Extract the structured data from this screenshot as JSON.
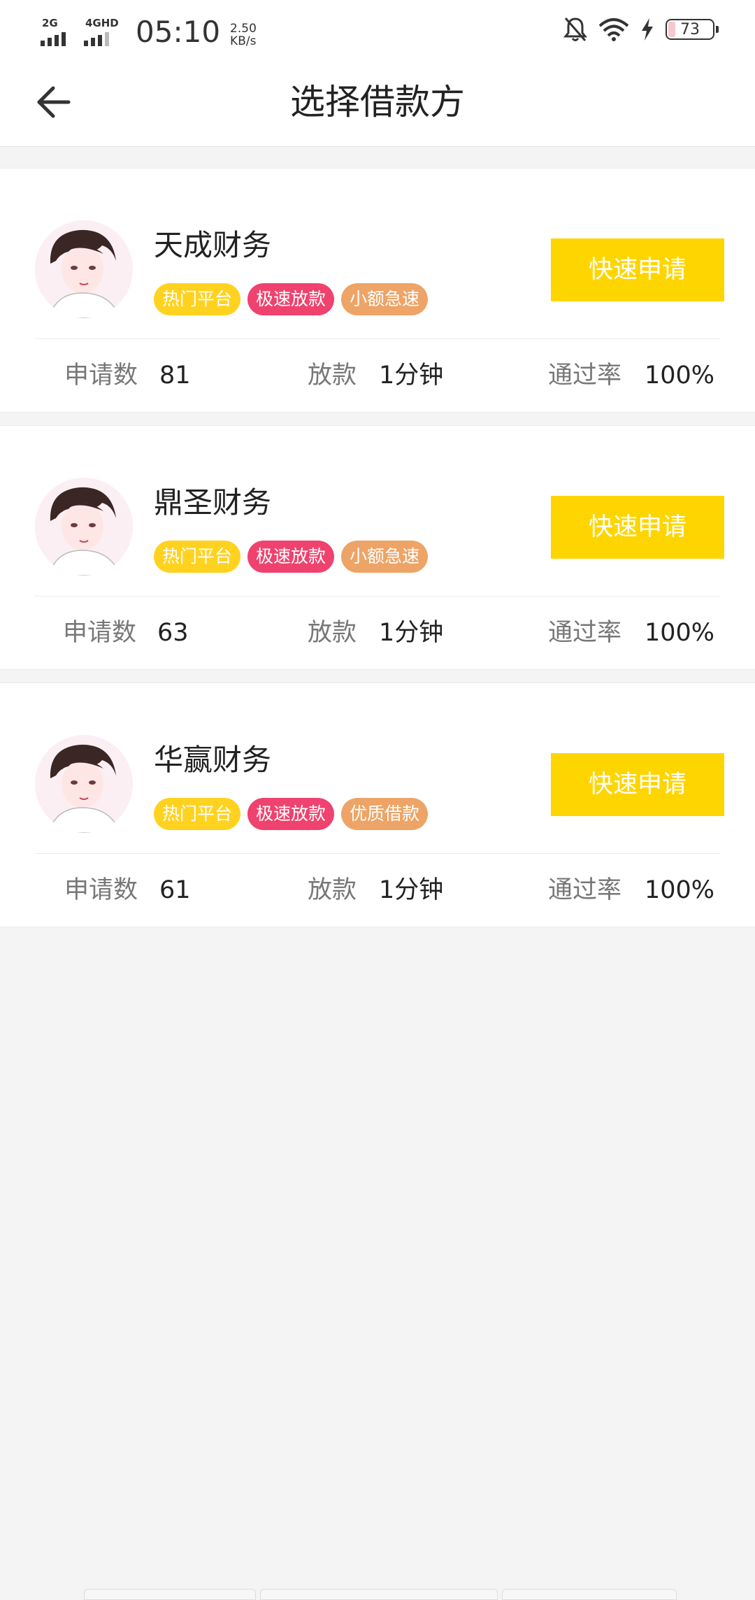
{
  "status_bar": {
    "net1": "2G",
    "net2": "4GHD",
    "time": "05:10",
    "speed_value": "2.50",
    "speed_unit": "KB/s",
    "battery": "73",
    "icons": [
      "signal-icon",
      "mute-bell-icon",
      "wifi-icon",
      "charging-icon",
      "battery-icon"
    ]
  },
  "header": {
    "title": "选择借款方",
    "back_icon": "back-arrow-icon"
  },
  "colors": {
    "accent_yellow": "#ffd500",
    "tag_yellow": "#ffd21f",
    "tag_pink": "#ef426e",
    "tag_orange": "#eda466"
  },
  "lenders": [
    {
      "name": "天成财务",
      "tags": [
        "热门平台",
        "极速放款",
        "小额急速"
      ],
      "apply_label": "快速申请",
      "apply_count_label": "申请数",
      "apply_count": "81",
      "loan_label": "放款",
      "loan_time": "1分钟",
      "pass_label": "通过率",
      "pass_rate": "100%"
    },
    {
      "name": "鼎圣财务",
      "tags": [
        "热门平台",
        "极速放款",
        "小额急速"
      ],
      "apply_label": "快速申请",
      "apply_count_label": "申请数",
      "apply_count": "63",
      "loan_label": "放款",
      "loan_time": "1分钟",
      "pass_label": "通过率",
      "pass_rate": "100%"
    },
    {
      "name": "华赢财务",
      "tags": [
        "热门平台",
        "极速放款",
        "优质借款"
      ],
      "apply_label": "快速申请",
      "apply_count_label": "申请数",
      "apply_count": "61",
      "loan_label": "放款",
      "loan_time": "1分钟",
      "pass_label": "通过率",
      "pass_rate": "100%"
    }
  ]
}
